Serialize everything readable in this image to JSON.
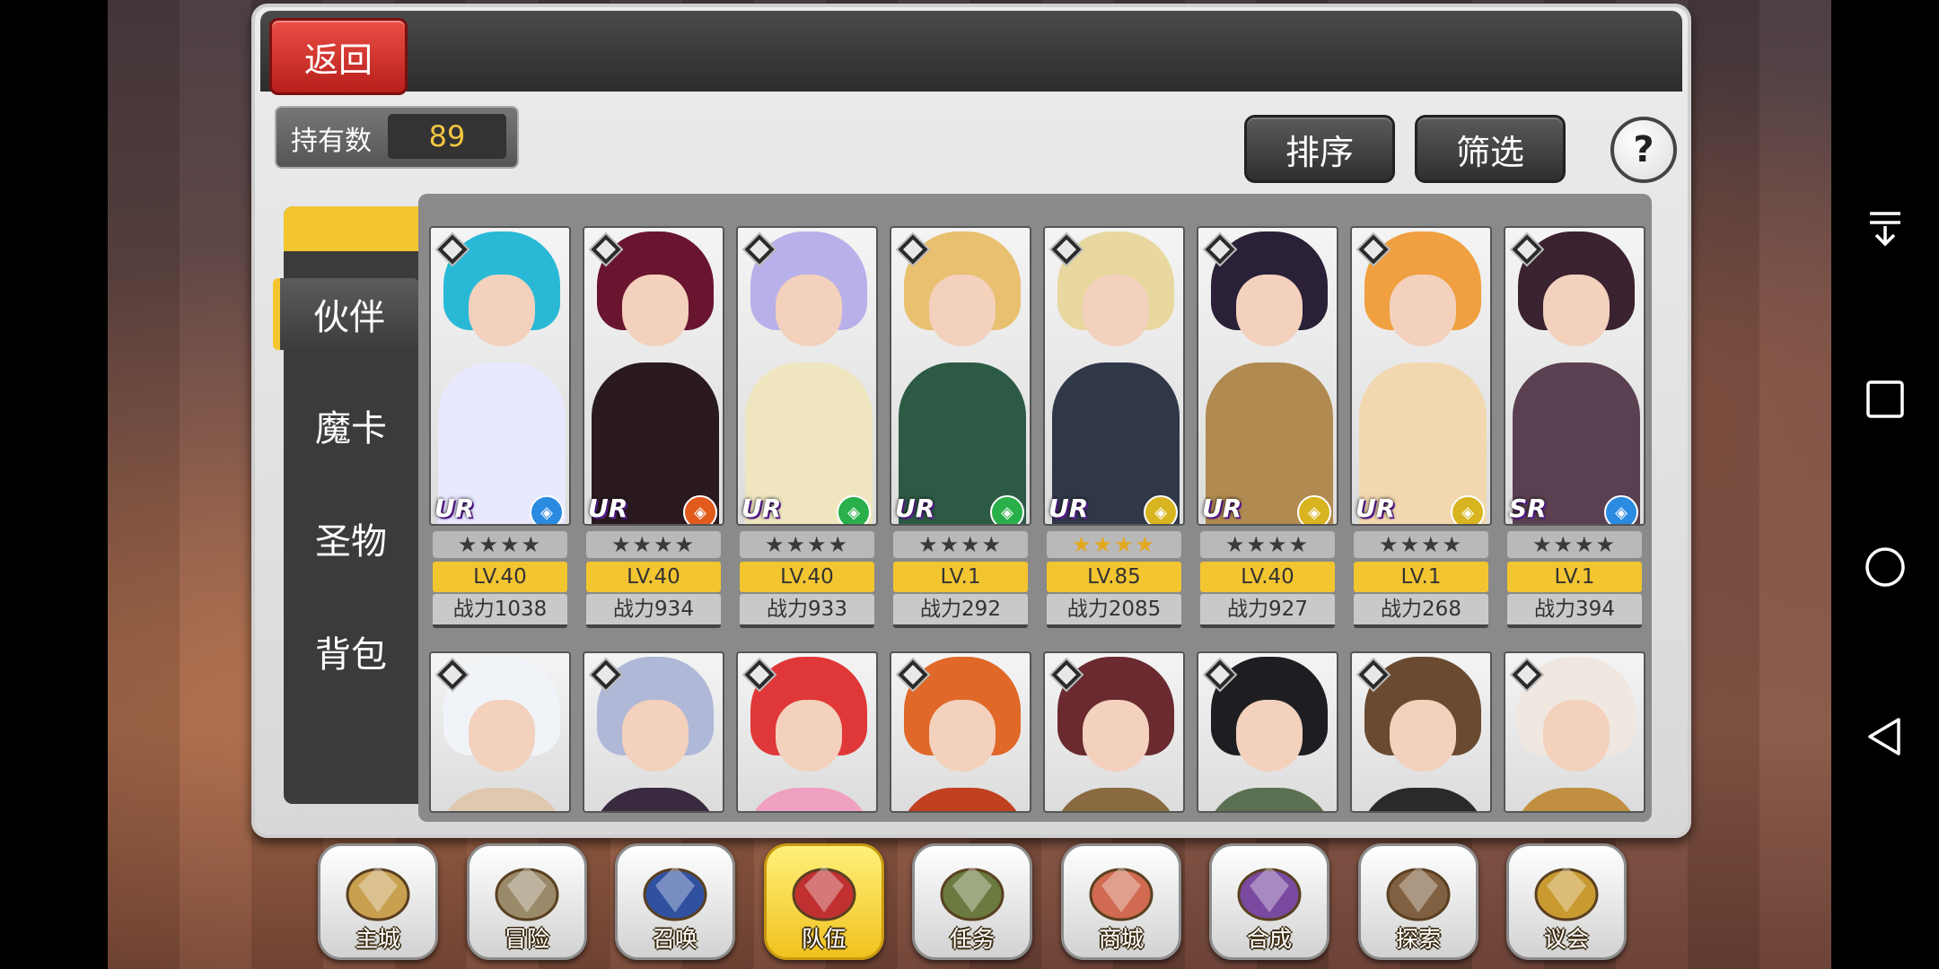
{
  "header": {
    "back_label": "返回"
  },
  "owned": {
    "label": "持有数",
    "value": "89"
  },
  "toolbar": {
    "sort_label": "排序",
    "filter_label": "筛选",
    "help_label": "?"
  },
  "tabs": [
    {
      "label": "伙伴",
      "active": true
    },
    {
      "label": "魔卡",
      "active": false
    },
    {
      "label": "圣物",
      "active": false
    },
    {
      "label": "背包",
      "active": false
    }
  ],
  "cards_row1": [
    {
      "rarity": "UR",
      "element_color": "#2a8be0",
      "stars": "★★★★",
      "gold": false,
      "level": "LV.40",
      "power": "战力1038",
      "hair": "#29b9d6",
      "body": "#e8e8ff"
    },
    {
      "rarity": "UR",
      "element_color": "#e25a1c",
      "stars": "★★★★",
      "gold": false,
      "level": "LV.40",
      "power": "战力934",
      "hair": "#6a1530",
      "body": "#2a1a20"
    },
    {
      "rarity": "UR",
      "element_color": "#2ab04a",
      "stars": "★★★★",
      "gold": false,
      "level": "LV.40",
      "power": "战力933",
      "hair": "#b8b0e8",
      "body": "#efe6c0"
    },
    {
      "rarity": "UR",
      "element_color": "#2ab04a",
      "stars": "★★★★",
      "gold": false,
      "level": "LV.1",
      "power": "战力292",
      "hair": "#e8c070",
      "body": "#2d5a45"
    },
    {
      "rarity": "UR",
      "element_color": "#d8b420",
      "stars": "★★★★",
      "gold": true,
      "level": "LV.85",
      "power": "战力2085",
      "hair": "#e8d8a0",
      "body": "#303848"
    },
    {
      "rarity": "UR",
      "element_color": "#d8b420",
      "stars": "★★★★",
      "gold": false,
      "level": "LV.40",
      "power": "战力927",
      "hair": "#2a2038",
      "body": "#b08a50"
    },
    {
      "rarity": "UR",
      "element_color": "#d8b420",
      "stars": "★★★★",
      "gold": false,
      "level": "LV.1",
      "power": "战力268",
      "hair": "#f0a040",
      "body": "#f2d8b0"
    },
    {
      "rarity": "SR",
      "element_color": "#2a8be0",
      "stars": "★★★★",
      "gold": false,
      "level": "LV.1",
      "power": "战力394",
      "hair": "#3a2230",
      "body": "#5a4050"
    }
  ],
  "cards_row2": [
    {
      "hair": "#f0f4f8",
      "body": "#e0c8b0"
    },
    {
      "hair": "#b0b8d8",
      "body": "#3a2a40"
    },
    {
      "hair": "#e03838",
      "body": "#f0a0c0"
    },
    {
      "hair": "#e06828",
      "body": "#c04020"
    },
    {
      "hair": "#6a2a30",
      "body": "#8a6a40"
    },
    {
      "hair": "#1e1e22",
      "body": "#5a7050"
    },
    {
      "hair": "#6a4a30",
      "body": "#2a2a2a"
    },
    {
      "hair": "#f0e8e0",
      "body": "#c09040"
    }
  ],
  "dock": [
    {
      "label": "主城",
      "icon": "crown-icon",
      "color": "#c8a050",
      "active": false
    },
    {
      "label": "冒险",
      "icon": "crossed-weapons-icon",
      "color": "#9a8a6a",
      "active": false
    },
    {
      "label": "召唤",
      "icon": "magic-card-icon",
      "color": "#3050a0",
      "active": false
    },
    {
      "label": "队伍",
      "icon": "winged-emblem-icon",
      "color": "#c03030",
      "active": true
    },
    {
      "label": "任务",
      "icon": "quest-book-icon",
      "color": "#6a7a40",
      "active": false
    },
    {
      "label": "商城",
      "icon": "shop-tree-icon",
      "color": "#d06a50",
      "active": false
    },
    {
      "label": "合成",
      "icon": "potion-flask-icon",
      "color": "#7a4aa0",
      "active": false
    },
    {
      "label": "探索",
      "icon": "pickaxe-compass-icon",
      "color": "#806040",
      "active": false
    },
    {
      "label": "议会",
      "icon": "council-crest-icon",
      "color": "#c89a30",
      "active": false
    }
  ]
}
